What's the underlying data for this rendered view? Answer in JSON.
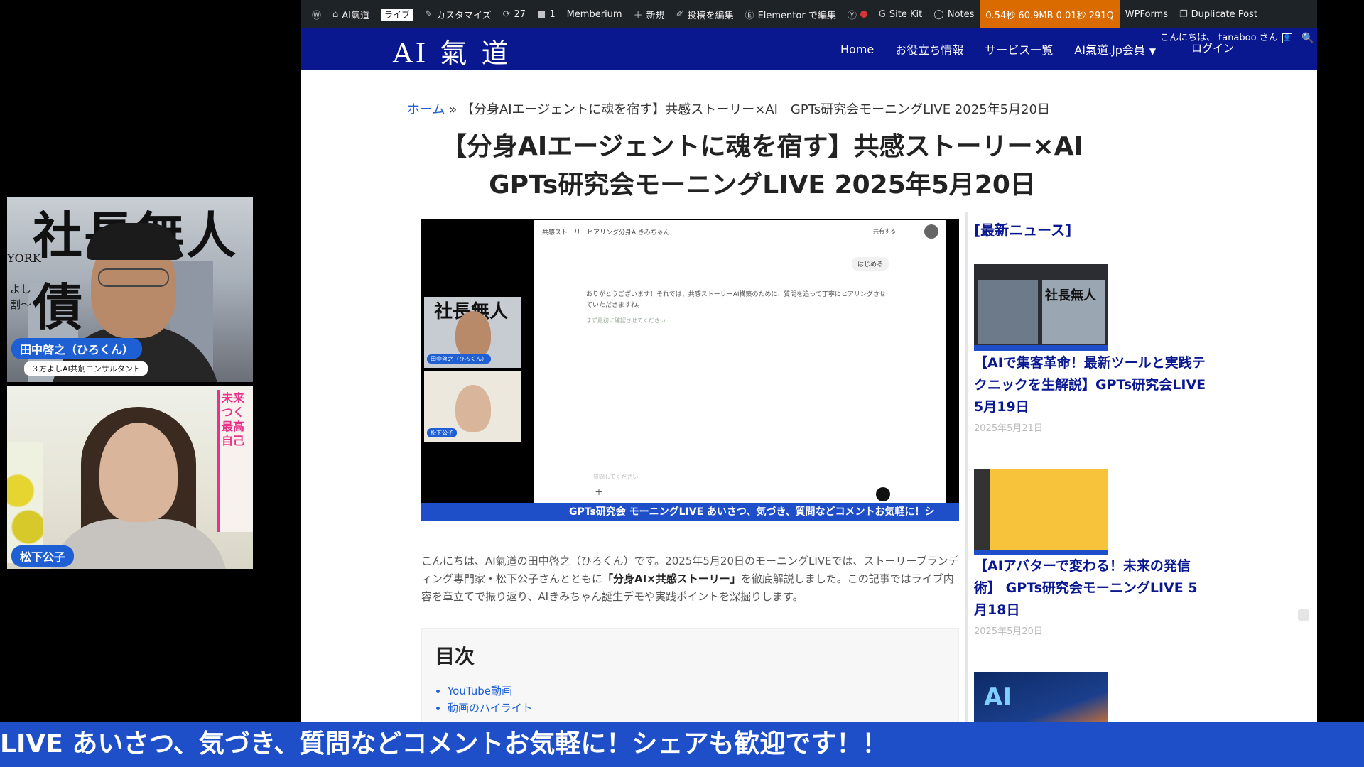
{
  "admin_bar": {
    "site_name": "AI氣道",
    "live_label": "ライブ",
    "customize": "カスタマイズ",
    "updates_count": "27",
    "comments_count": "1",
    "memberium": "Memberium",
    "new": "新規",
    "edit_post": "投稿を編集",
    "elementor": "Elementor で編集",
    "sitekit": "Site Kit",
    "notes": "Notes",
    "perf": "0.54秒  60.9MB  0.01秒  291Q",
    "wpforms": "WPForms",
    "duplicate": "Duplicate Post"
  },
  "header": {
    "logo": "AI 氣 道",
    "nav": [
      "Home",
      "お役立ち情報",
      "サービス一覧",
      "AI氣道.Jp会員"
    ],
    "greeting": "こんにちは、 tanaboo さん",
    "login": "ログイン"
  },
  "breadcrumb": {
    "home": "ホーム",
    "sep": " » ",
    "current": "【分身AIエージェントに魂を宿す】共感ストーリー×AI　GPTs研究会モーニングLIVE 2025年5月20日"
  },
  "post": {
    "title": "【分身AIエージェントに魂を宿す】共感ストーリー×AI　GPTs研究会モーニングLIVE 2025年5月20日",
    "intro_before": "こんにちは、AI氣道の田中啓之（ひろくん）です。2025年5月20日のモーニングLIVEでは、ストーリーブランディング専門家・松下公子さんとともに",
    "intro_bold": "「分身AI×共感ストーリー」",
    "intro_after": "を徹底解説しました。この記事ではライブ内容を章立てで振り返り、AIきみちゃん誕生デモや実践ポイントを深掘りします。",
    "toc_title": "目次",
    "toc_items": [
      "YouTube動画",
      "動画のハイライト",
      "…"
    ]
  },
  "video": {
    "app_title": "共感ストーリーヒアリング分身AIきみちゃん",
    "share": "共有する",
    "start_button": "はじめる",
    "message": "ありがとうございます！それでは、共感ストーリーAI構築のために、質問を追って丁寧にヒアリングさせていただきますね。",
    "message2": "まず最初に確認させてください",
    "input_placeholder": "質問してください",
    "mini_bg": "社長無人",
    "mini_name1": "田中啓之（ひろくん）",
    "mini_name2": "松下公子",
    "banner": "GPTs研究会 モーニングLIVE あいさつ、気づき、質問などコメントお気軽に！シ"
  },
  "sidebar": {
    "heading": "[最新ニュース]",
    "news": [
      {
        "title": "【AIで集客革命！最新ツールと実践テクニックを生解説】GPTs研究会LIVE 5月19日",
        "date": "2025年5月21日"
      },
      {
        "title": "【AIアバターで変わる！未来の発信術】 GPTs研究会モーニングLIVE 5月18日",
        "date": "2025年5月20日"
      }
    ],
    "thumb1_text": "社長無人",
    "thumb3_text": "AI"
  },
  "cams": {
    "cam1_bg": "社長無人債",
    "cam1_york": "YORK",
    "cam1_side": "よし\n割〜",
    "cam1_name": "田中啓之（ひろくん）",
    "cam1_role": "３方よしAI共創コンサルタント",
    "cam2_book": "未来\nつく\n最高\n自己",
    "cam2_name": "松下公子"
  },
  "ticker": {
    "text": "LIVE あいさつ、気づき、質問などコメントお気軽に！シェアも歓迎です！！"
  },
  "colors": {
    "brand_navy": "#0a1890",
    "accent_blue": "#1e5fd4",
    "admin_bar": "#1d2327"
  }
}
